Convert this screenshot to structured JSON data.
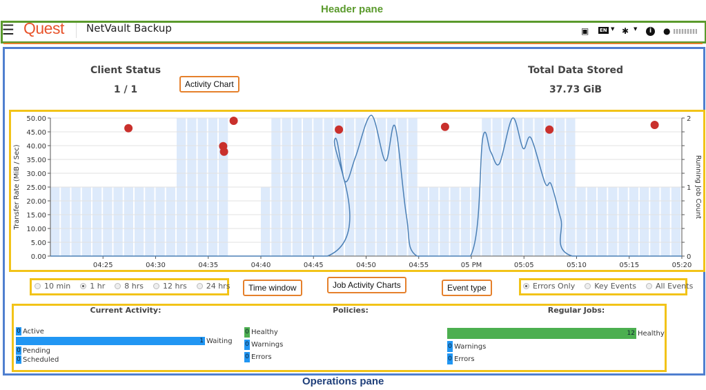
{
  "annotations": {
    "header_pane": "Header pane",
    "operations_pane": "Operations pane",
    "activity_chart": "Activity Chart",
    "time_window": "Time window",
    "job_activity_charts": "Job Activity Charts",
    "event_type": "Event type"
  },
  "header": {
    "brand": "Quest",
    "app_name": "NetVault Backup",
    "language": "EN",
    "icons": [
      "menu-icon",
      "video-icon",
      "language-icon",
      "tools-icon",
      "info-icon",
      "user-icon"
    ]
  },
  "status": {
    "client_status_label": "Client Status",
    "client_status_value": "1 / 1",
    "total_data_label": "Total Data Stored",
    "total_data_value": "37.73 GiB"
  },
  "chart_data": {
    "type": "line",
    "ylabel": "Transfer Rate (MiB / Sec)",
    "y2label": "Running Job Count",
    "ylim": [
      0,
      50
    ],
    "y2lim": [
      0,
      2
    ],
    "xlim": [
      "04:20",
      "05:20"
    ],
    "x_ticks": [
      "04:25",
      "04:30",
      "04:35",
      "04:40",
      "04:45",
      "04:50",
      "04:55",
      "05 PM",
      "05:05",
      "05:10",
      "05:15",
      "05:20"
    ],
    "y_ticks": [
      "0.00",
      "5.00",
      "10.00",
      "15.00",
      "20.00",
      "25.00",
      "30.00",
      "35.00",
      "40.00",
      "45.00",
      "50.00"
    ],
    "y2_ticks": [
      "0",
      "1",
      "2"
    ],
    "grid": true,
    "transfer_rate": [
      [
        "04:20:00",
        0
      ],
      [
        "04:46:20",
        0
      ],
      [
        "04:47:00",
        42
      ],
      [
        "04:48:00",
        27
      ],
      [
        "04:49:00",
        36
      ],
      [
        "04:50:30",
        51
      ],
      [
        "04:51:50",
        34.5
      ],
      [
        "04:52:45",
        47
      ],
      [
        "04:53:50",
        14.5
      ],
      [
        "04:54:50",
        0
      ],
      [
        "04:59:55",
        0
      ],
      [
        "05:01:05",
        42.8
      ],
      [
        "05:01:50",
        37.8
      ],
      [
        "05:02:40",
        33.5
      ],
      [
        "05:03:55",
        50
      ],
      [
        "05:04:55",
        39
      ],
      [
        "05:05:40",
        42.8
      ],
      [
        "05:07:00",
        26.5
      ],
      [
        "05:07:35",
        26
      ],
      [
        "05:08:30",
        13.5
      ],
      [
        "05:09:35",
        0
      ],
      [
        "05:20:00",
        0
      ]
    ],
    "running_job_count": [
      {
        "from": "04:20",
        "to": "04:32",
        "count": 1
      },
      {
        "from": "04:32",
        "to": "04:37",
        "count": 2
      },
      {
        "from": "04:37",
        "to": "04:40",
        "count": 0
      },
      {
        "from": "04:40",
        "to": "04:41",
        "count": 1
      },
      {
        "from": "04:41",
        "to": "04:55",
        "count": 2
      },
      {
        "from": "04:55",
        "to": "05:01",
        "count": 1
      },
      {
        "from": "05:01",
        "to": "05:10",
        "count": 2
      },
      {
        "from": "05:10",
        "to": "05:20",
        "count": 1
      }
    ],
    "error_events": [
      [
        "04:27:25",
        46.3
      ],
      [
        "04:36:25",
        39.8
      ],
      [
        "04:36:30",
        37.8
      ],
      [
        "04:37:25",
        49
      ],
      [
        "04:47:25",
        45.8
      ],
      [
        "04:57:30",
        46.8
      ],
      [
        "05:07:25",
        45.8
      ],
      [
        "05:17:25",
        47.5
      ]
    ],
    "colors": {
      "line": "#4a7fb5",
      "band": "#ddeafb",
      "event": "#c9302c"
    }
  },
  "time_window": {
    "options": [
      "10 min",
      "1 hr",
      "8 hrs",
      "12 hrs",
      "24 hrs"
    ],
    "selected": "1 hr"
  },
  "event_type": {
    "options": [
      "Errors Only",
      "Key Events",
      "All Events"
    ],
    "selected": "Errors Only"
  },
  "job_activity": {
    "current_activity": {
      "title": "Current Activity:",
      "rows": [
        {
          "label": "Active",
          "value": "0"
        },
        {
          "label": "Waiting",
          "value": "1"
        },
        {
          "label": "Pending",
          "value": "0"
        },
        {
          "label": "Scheduled",
          "value": "0"
        }
      ]
    },
    "policies": {
      "title": "Policies:",
      "rows": [
        {
          "label": "Healthy",
          "value": "0"
        },
        {
          "label": "Warnings",
          "value": "0"
        },
        {
          "label": "Errors",
          "value": "0"
        }
      ]
    },
    "regular_jobs": {
      "title": "Regular Jobs:",
      "rows": [
        {
          "label": "Healthy",
          "value": "12"
        },
        {
          "label": "Warnings",
          "value": "0"
        },
        {
          "label": "Errors",
          "value": "0"
        }
      ]
    }
  }
}
